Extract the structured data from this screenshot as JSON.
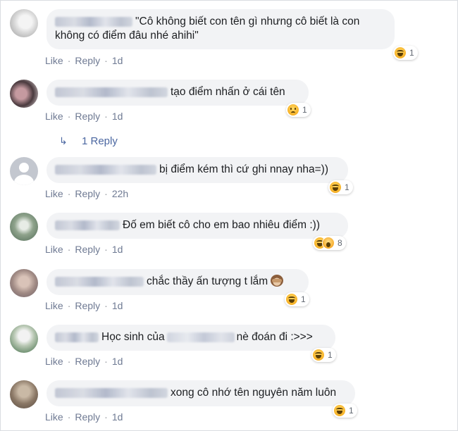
{
  "ui": {
    "like_label": "Like",
    "reply_label": "Reply",
    "separator": "·"
  },
  "comments": [
    {
      "text": "\"Cô không biết con tên gì nhưng cô biết là con không có điểm đâu nhé ahihi\"",
      "time": "1d",
      "reaction_count": "1",
      "reaction_type": "haha"
    },
    {
      "text": "tạo điểm nhấn ở cái tên",
      "time": "1d",
      "reaction_count": "1",
      "reaction_type": "sad"
    },
    {
      "text": "bị điểm kém thì cứ ghi nnay nha=))",
      "time": "22h",
      "reaction_count": "1",
      "reaction_type": "haha"
    },
    {
      "text": "Đố em biết cô cho em bao nhiêu điểm :))",
      "time": "1d",
      "reaction_count": "8",
      "reaction_type": "haha+wow"
    },
    {
      "text": "chắc thầy ấn tượng t lắm",
      "time": "1d",
      "reaction_count": "1",
      "reaction_type": "haha"
    },
    {
      "text_before": "Học sinh của",
      "text_after": "nè đoán đi :>>>",
      "time": "1d",
      "reaction_count": "1",
      "reaction_type": "haha"
    },
    {
      "text": "xong cô nhớ tên nguyên năm luôn",
      "time": "1d",
      "reaction_count": "1",
      "reaction_type": "haha"
    }
  ],
  "replies_link": {
    "label": "1 Reply"
  },
  "colors": {
    "bubble": "#f2f3f5",
    "meta": "#6f7a93",
    "link": "#4b67a1",
    "text": "#1c1e21"
  }
}
